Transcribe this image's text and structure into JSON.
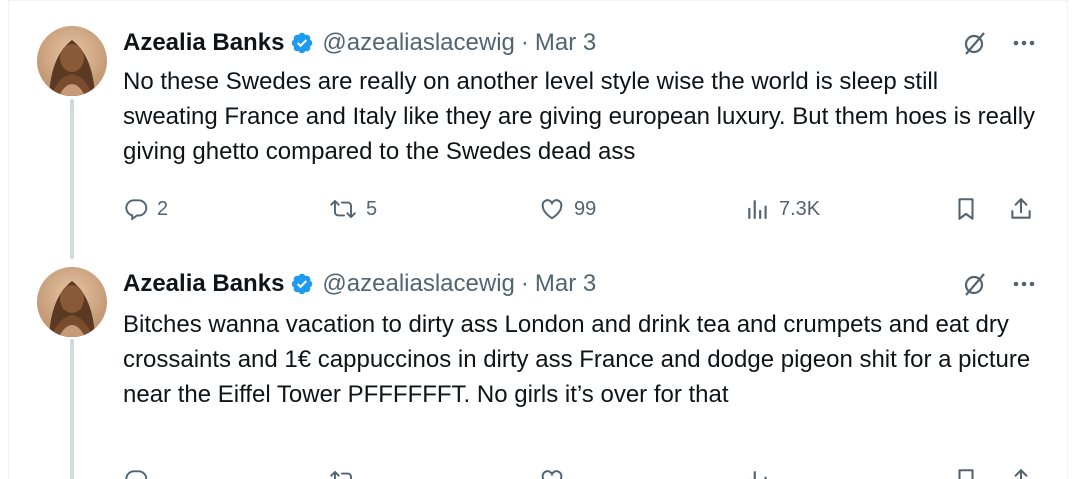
{
  "colors": {
    "accent": "#1d9bf0",
    "text_primary": "#0f1419",
    "text_secondary": "#536471",
    "thread_line": "#cfd9de"
  },
  "tweets": [
    {
      "author_name": "Azealia Banks",
      "handle": "@azealiaslacewig",
      "separator": "·",
      "date": "Mar 3",
      "text": "No these Swedes are really on another level style wise the world is sleep still sweating France and Italy like they are giving european luxury. But them hoes is really giving ghetto compared to the Swedes dead ass",
      "replies": "2",
      "reposts": "5",
      "likes": "99",
      "views": "7.3K",
      "icons": {
        "verified": "verified-badge-icon",
        "grok": "slashed-circle-icon",
        "more": "more-dots-icon",
        "reply": "reply-icon",
        "repost": "repost-icon",
        "like": "heart-icon",
        "views": "views-bar-icon",
        "bookmark": "bookmark-icon",
        "share": "share-icon"
      }
    },
    {
      "author_name": "Azealia Banks",
      "handle": "@azealiaslacewig",
      "separator": "·",
      "date": "Mar 3",
      "text": "Bitches wanna vacation to dirty ass London and drink tea and crumpets and eat dry crossaints and 1€ cappuccinos in dirty ass France and dodge pigeon shit for a picture near the Eiffel Tower PFFFFFFT. No girls it’s over for that"
    }
  ]
}
